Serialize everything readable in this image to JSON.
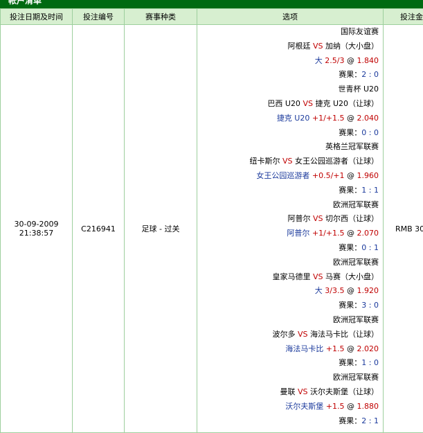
{
  "window": {
    "title": "帐户清单"
  },
  "table": {
    "headers": [
      "投注日期及时间",
      "投注编号",
      "赛事种类",
      "选项",
      "投注金"
    ],
    "row": {
      "date": "30-09-2009",
      "time": "21:38:57",
      "bet_id": "C216941",
      "event_type": "足球 - 过关",
      "amount": "RMB 30"
    },
    "vs_label": "VS",
    "at_label": "@",
    "result_label": "赛果：",
    "selections": [
      {
        "league": "国际友谊赛",
        "home": "阿根廷",
        "away": "加纳",
        "type": "（大小盘）",
        "pick": "大",
        "line": "2.5/3",
        "odds": "1.840",
        "result": "2 : 0"
      },
      {
        "league": "世青杯 U20",
        "home": "巴西 U20",
        "away": "捷克 U20",
        "type": "（让球）",
        "pick": "捷克 U20",
        "line": "+1/+1.5",
        "odds": "2.040",
        "result": "0 : 0"
      },
      {
        "league": "英格兰冠军联赛",
        "home": "纽卡斯尔",
        "away": "女王公园巡游者",
        "type": "（让球）",
        "pick": "女王公园巡游者",
        "line": "+0.5/+1",
        "odds": "1.960",
        "result": "1 : 1"
      },
      {
        "league": "欧洲冠军联赛",
        "home": "阿普尔",
        "away": "切尔西",
        "type": "（让球）",
        "pick": "阿普尔",
        "line": "+1/+1.5",
        "odds": "2.070",
        "result": "0 : 1"
      },
      {
        "league": "欧洲冠军联赛",
        "home": "皇家马德里",
        "away": "马赛",
        "type": "（大小盘）",
        "pick": "大",
        "line": "3/3.5",
        "odds": "1.920",
        "result": "3 : 0"
      },
      {
        "league": "欧洲冠军联赛",
        "home": "波尔多",
        "away": "海法马卡比",
        "type": "（让球）",
        "pick": "海法马卡比",
        "line": "+1.5",
        "odds": "2.020",
        "result": "1 : 0"
      },
      {
        "league": "欧洲冠军联赛",
        "home": "曼联",
        "away": "沃尔夫斯堡",
        "type": "（让球）",
        "pick": "沃尔夫斯堡",
        "line": "+1.5",
        "odds": "1.880",
        "result": "2 : 1"
      }
    ]
  },
  "colors": {
    "header_bg": "#d7efd0",
    "title_bg": "#006a11",
    "border": "#9dcf9d",
    "vs": "#c00000",
    "pick": "#1b3a9c",
    "result": "#1b3a9c"
  }
}
